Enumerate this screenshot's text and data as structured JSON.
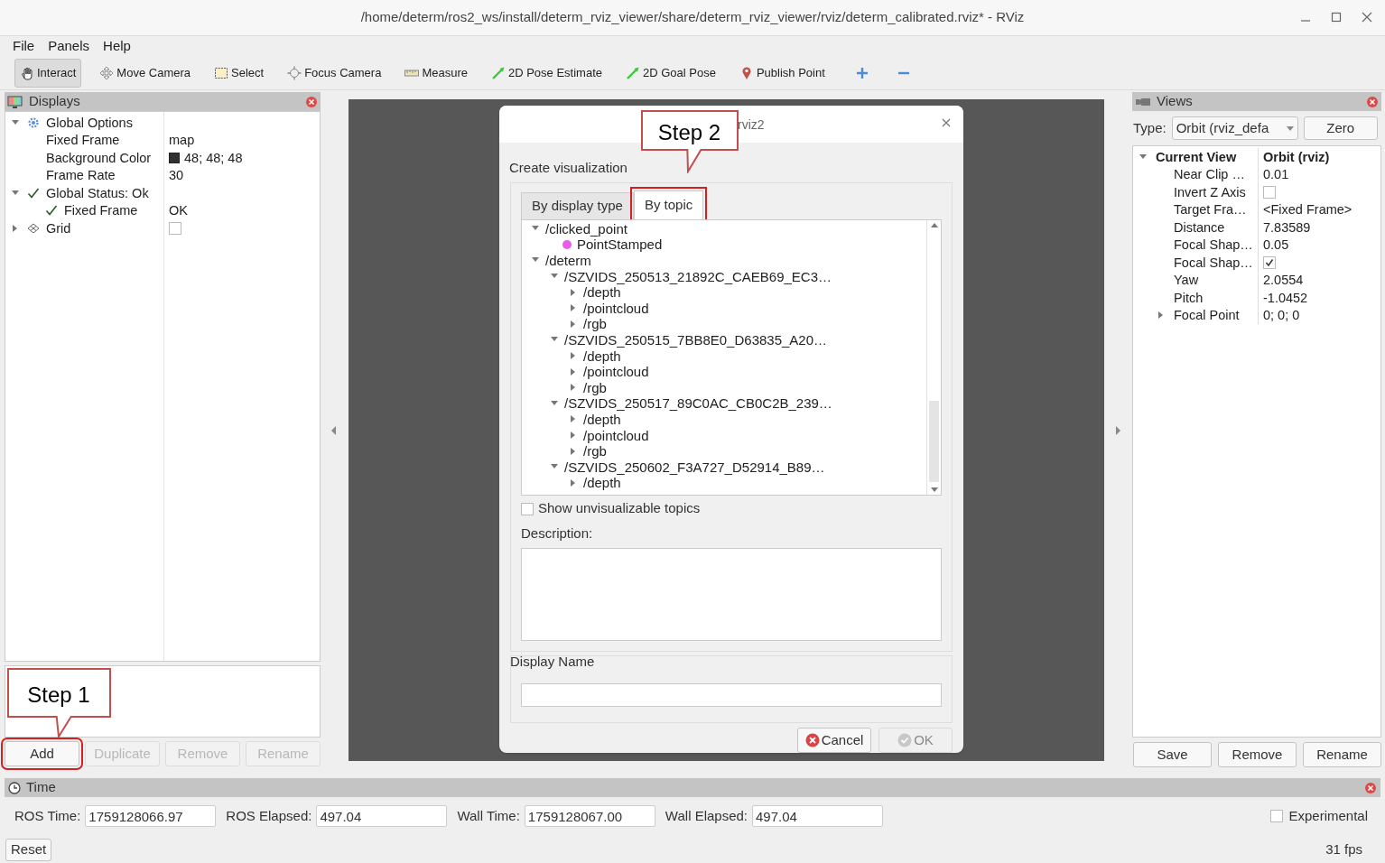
{
  "window": {
    "title": "/home/determ/ros2_ws/install/determ_rviz_viewer/share/determ_rviz_viewer/rviz/determ_calibrated.rviz* - RViz"
  },
  "menu": [
    "File",
    "Panels",
    "Help"
  ],
  "toolbar": [
    {
      "kind": "hand",
      "label": "Interact",
      "selected": true
    },
    {
      "kind": "move",
      "label": "Move Camera",
      "selected": false
    },
    {
      "kind": "select",
      "label": "Select",
      "selected": false
    },
    {
      "kind": "focus",
      "label": "Focus Camera",
      "selected": false
    },
    {
      "kind": "ruler",
      "label": "Measure",
      "selected": false
    },
    {
      "kind": "arrow",
      "label": "2D Pose Estimate",
      "selected": false
    },
    {
      "kind": "arrow",
      "label": "2D Goal Pose",
      "selected": false
    },
    {
      "kind": "pin",
      "label": "Publish Point",
      "selected": false
    },
    {
      "kind": "plus",
      "selected": false
    },
    {
      "kind": "minus",
      "selected": false
    }
  ],
  "displays": {
    "title": "Displays",
    "tree": [
      {
        "label": "Global Options",
        "kind": "gear",
        "expanded": true,
        "children": [
          {
            "label": "Fixed Frame",
            "value": "map"
          },
          {
            "label": "Background Color",
            "value": "48; 48; 48",
            "color": "#303030"
          },
          {
            "label": "Frame Rate",
            "value": "30"
          }
        ]
      },
      {
        "label": "Global Status: Ok",
        "kind": "check",
        "expanded": true,
        "children": [
          {
            "label": "Fixed Frame",
            "kind": "check",
            "value": "OK"
          }
        ]
      },
      {
        "label": "Grid",
        "kind": "grid",
        "expanded": false,
        "checked": false
      }
    ],
    "buttons": [
      {
        "label": "Add",
        "disabled": false
      },
      {
        "label": "Duplicate",
        "disabled": true
      },
      {
        "label": "Remove",
        "disabled": true
      },
      {
        "label": "Rename",
        "disabled": true
      }
    ]
  },
  "views": {
    "title": "Views",
    "type_label": "Type:",
    "type_value": "Orbit (rviz_defa",
    "zero_button": "Zero",
    "tree": [
      {
        "label": "Current View",
        "value": "Orbit (rviz)",
        "expanded": true,
        "children": [
          {
            "label": "Near Clip …",
            "value": "0.01"
          },
          {
            "label": "Invert Z Axis",
            "checked": false
          },
          {
            "label": "Target Fra…",
            "value": "<Fixed Frame>"
          },
          {
            "label": "Distance",
            "value": "7.83589"
          },
          {
            "label": "Focal Shap…",
            "value": "0.05"
          },
          {
            "label": "Focal Shap…",
            "checked": true
          },
          {
            "label": "Yaw",
            "value": "2.0554"
          },
          {
            "label": "Pitch",
            "value": "-1.0452"
          },
          {
            "label": "Focal Point",
            "value": "0; 0; 0",
            "expanded": false
          }
        ]
      }
    ],
    "buttons": [
      {
        "label": "Save",
        "disabled": false
      },
      {
        "label": "Remove",
        "disabled": false
      },
      {
        "label": "Rename",
        "disabled": false
      }
    ]
  },
  "dialog": {
    "title": "rviz2",
    "heading": "Create visualization",
    "tabs": [
      {
        "label": "By display type",
        "selected": false
      },
      {
        "label": "By topic",
        "selected": true
      }
    ],
    "topics": [
      {
        "label": "/clicked_point",
        "expanded": true,
        "children": [
          {
            "label": "PointStamped",
            "color": "#e85ce8"
          }
        ]
      },
      {
        "label": "/determ",
        "expanded": true,
        "children": [
          {
            "label": "/SZVIDS_250513_21892C_CAEB69_EC3…",
            "expanded": true,
            "children": [
              {
                "label": "/depth",
                "expanded": false
              },
              {
                "label": "/pointcloud",
                "expanded": false
              },
              {
                "label": "/rgb",
                "expanded": false
              }
            ]
          },
          {
            "label": "/SZVIDS_250515_7BB8E0_D63835_A20…",
            "expanded": true,
            "children": [
              {
                "label": "/depth",
                "expanded": false
              },
              {
                "label": "/pointcloud",
                "expanded": false
              },
              {
                "label": "/rgb",
                "expanded": false
              }
            ]
          },
          {
            "label": "/SZVIDS_250517_89C0AC_CB0C2B_239…",
            "expanded": true,
            "children": [
              {
                "label": "/depth",
                "expanded": false
              },
              {
                "label": "/pointcloud",
                "expanded": false
              },
              {
                "label": "/rgb",
                "expanded": false
              }
            ]
          },
          {
            "label": "/SZVIDS_250602_F3A727_D52914_B89…",
            "expanded": true,
            "children": [
              {
                "label": "/depth",
                "expanded": false
              }
            ]
          }
        ]
      }
    ],
    "show_unvisualizable": {
      "label": "Show unvisualizable topics",
      "checked": false
    },
    "description_label": "Description:",
    "display_name_label": "Display Name",
    "buttons": [
      {
        "kind": "cancel",
        "label": "Cancel",
        "disabled": false
      },
      {
        "kind": "ok",
        "label": "OK",
        "disabled": true
      }
    ]
  },
  "annotations": [
    {
      "text": "Step 1"
    },
    {
      "text": "Step 2"
    }
  ],
  "time": {
    "title": "Time",
    "fields": [
      {
        "label": "ROS Time:",
        "value": "1759128066.97"
      },
      {
        "label": "ROS Elapsed:",
        "value": "497.04"
      },
      {
        "label": "Wall Time:",
        "value": "1759128067.00"
      },
      {
        "label": "Wall Elapsed:",
        "value": "497.04"
      }
    ],
    "experimental": {
      "label": "Experimental",
      "checked": false
    },
    "reset_button": "Reset",
    "fps": "31 fps"
  }
}
